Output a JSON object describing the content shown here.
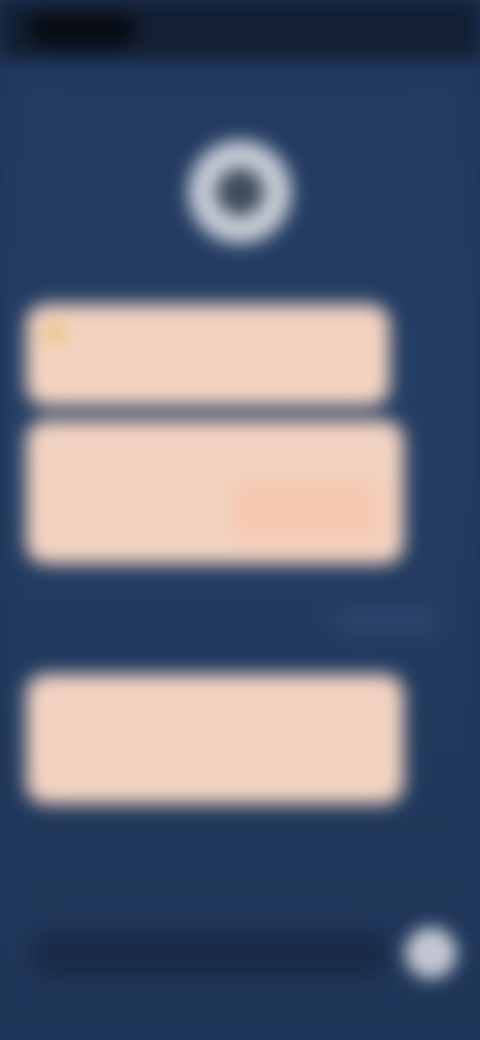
{
  "status_bar": {
    "time": "",
    "right_indicators": ""
  },
  "nav": {
    "back_icon": "chevron-left-icon",
    "menu_icon": "more-icon"
  },
  "avatar": {
    "icon": "user-avatar-icon"
  },
  "messages": [
    {
      "text": ""
    },
    {
      "text": ""
    },
    {
      "text": ""
    }
  ],
  "timestamp": "",
  "composer": {
    "placeholder": "",
    "send_icon": "send-icon"
  },
  "colors": {
    "background": "#223a5f",
    "bubble": "#f2d3c1",
    "status_bar": "#131f33"
  }
}
